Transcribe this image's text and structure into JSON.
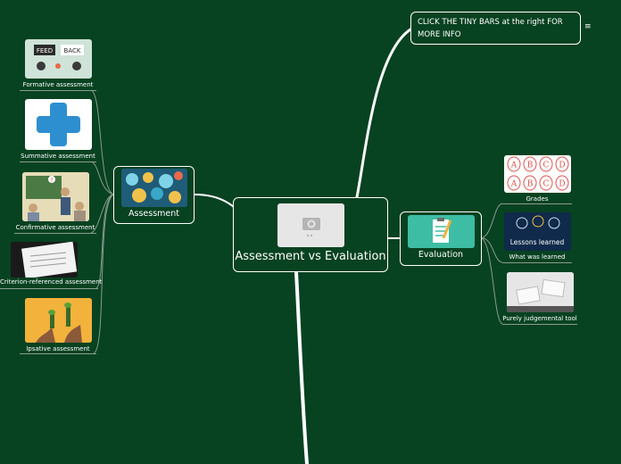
{
  "central": {
    "title": "Assessment vs Evaluation",
    "image_icon": "camera-icon"
  },
  "note": {
    "text": "CLICK THE TINY BARS at the right FOR MORE INFO",
    "menu_icon": "hamburger-icon"
  },
  "assessment": {
    "title": "Assessment",
    "children": [
      {
        "label": "Formative assessment",
        "image": "feedback-icon"
      },
      {
        "label": "Summative assessment",
        "image": "plus-icon"
      },
      {
        "label": "Confirmative assessment",
        "image": "classroom-icon"
      },
      {
        "label": "Criterion-referenced assessment",
        "image": "checklist-icon"
      },
      {
        "label": "Ipsative assessment",
        "image": "plants-icon"
      }
    ]
  },
  "evaluation": {
    "title": "Evaluation",
    "children": [
      {
        "label": "Grades",
        "image": "grades-icon"
      },
      {
        "label": "What was learned",
        "image": "lessons-learned-icon",
        "image_text": "Lessons learned"
      },
      {
        "label": "Purely judgemental tool",
        "image": "word-cubes-icon"
      }
    ]
  },
  "colors": {
    "background": "#074221",
    "line": "#ffffff",
    "evaluation_thumb": "#3dbda3",
    "formative_thumb": "#cfe3d8",
    "summative_plus": "#2e8fd0",
    "ipsative_thumb": "#f3b23c"
  },
  "grade_letters": [
    "A",
    "B",
    "C",
    "D",
    "A",
    "B",
    "C",
    "D"
  ]
}
